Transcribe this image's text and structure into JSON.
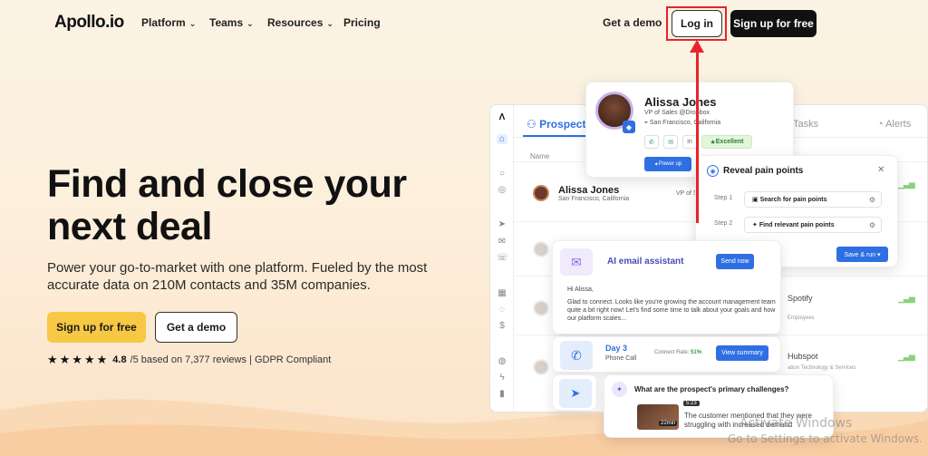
{
  "nav": {
    "logo": "Apollo.io",
    "items": [
      {
        "label": "Platform",
        "has_dropdown": true
      },
      {
        "label": "Teams",
        "has_dropdown": true
      },
      {
        "label": "Resources",
        "has_dropdown": true
      },
      {
        "label": "Pricing",
        "has_dropdown": false
      }
    ],
    "get_demo": "Get a demo",
    "login": "Log in",
    "signup": "Sign up for free"
  },
  "hero": {
    "title": "Find and close your next deal",
    "subtitle": "Power your go-to-market with one platform. Fueled by the most accurate data on 210M contacts and 35M companies.",
    "primary_cta": "Sign up for free",
    "secondary_cta": "Get a demo",
    "stars": "★★★★★",
    "rating_value": "4.8",
    "rating_suffix": "/5 based on 7,377 reviews | GDPR Compliant"
  },
  "app": {
    "tabs": {
      "prospects": "Prospects",
      "tasks": "Tasks",
      "alerts": "Alerts"
    },
    "column_name": "Name",
    "row": {
      "name": "Alissa Jones",
      "location": "San Francisco, California",
      "title": "VP of Sales"
    },
    "companies": [
      {
        "name": "Spotify",
        "sub": "Employees"
      },
      {
        "name": "Hubspot",
        "sub": "ation Technology & Services"
      }
    ]
  },
  "profile_card": {
    "name": "Alissa Jones",
    "role": "VP of Sales @Dropbox",
    "location": "San Francisco, California",
    "chip_linkedin": "in",
    "chip_excellent": "Excellent",
    "power_up": "Power up"
  },
  "pain_card": {
    "title": "Reveal pain points",
    "steps": [
      {
        "label": "Step 1",
        "text": "Search for pain points"
      },
      {
        "label": "Step 2",
        "text": "Find relevant pain points"
      }
    ],
    "save_run": "Save & run ▾"
  },
  "email_card": {
    "title": "AI email assistant",
    "send_now": "Send now",
    "greeting": "Hi Alissa,",
    "body": "Glad to connect. Looks like you're growing the account management team quite a bit right now! Let's find some time to talk about your goals and how our platform scales..."
  },
  "call_card": {
    "day": "Day 3",
    "type": "Phone Call",
    "connect_rate_label": "Connect Rate:",
    "connect_rate_value": "51%",
    "view_summary": "View summary"
  },
  "question_card": {
    "question": "What are the prospect's primary challenges?",
    "timestamp": "5:23",
    "duration": "22min",
    "answer": "The customer mentioned that they were struggling with increased demand"
  },
  "watermark": {
    "line1": "Activate Windows",
    "line2": "Go to Settings to activate Windows."
  },
  "colors": {
    "accent": "#2f6fe4",
    "cta": "#f7c843",
    "annotation": "#e8232a"
  }
}
